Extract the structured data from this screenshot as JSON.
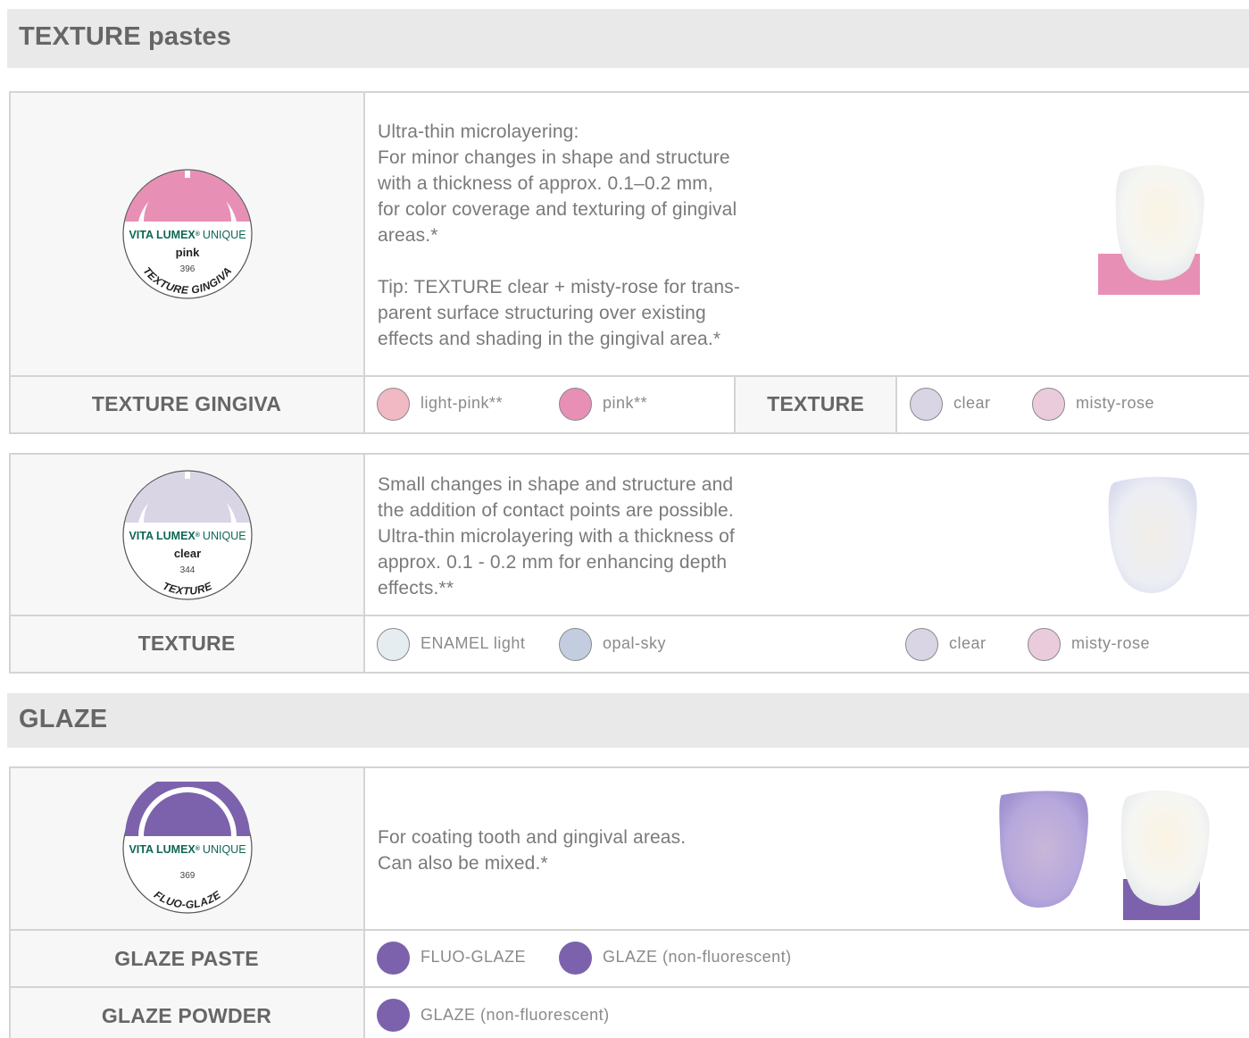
{
  "colors": {
    "pink": "#e88fb5",
    "light_pink": "#f1b9c3",
    "clear": "#d9d5e4",
    "misty_rose": "#eacbdc",
    "enamel_light": "#e6edf1",
    "opal_sky": "#c2cde0",
    "glaze_purple": "#7c62ac",
    "vita_green": "#0e6655"
  },
  "texture_section": {
    "title": "TEXTURE pastes"
  },
  "gingiva_block": {
    "jar": {
      "brand": "VITA LUMEX",
      "reg": "®",
      "product": "UNIQUE",
      "shade": "pink",
      "number": "396",
      "arc_text": "TEXTURE GINGIVA"
    },
    "description": "Ultra-thin microlayering:\nFor minor changes in shape and structure\nwith a thickness of approx. 0.1–0.2 mm,\nfor color coverage and texturing of gingival\nareas.*\n\nTip: TEXTURE clear + misty-rose for trans-\nparent surface structuring over existing\neffects and shading in the gingival area.*",
    "row_label": "TEXTURE GINGIVA",
    "swatches": [
      {
        "label": "light-pink**",
        "color": "#f1b9c3"
      },
      {
        "label": "pink**",
        "color": "#e88fb5"
      }
    ],
    "row_label_2": "TEXTURE",
    "swatches_2": [
      {
        "label": "clear",
        "color": "#d9d5e4"
      },
      {
        "label": "misty-rose",
        "color": "#eacbdc"
      }
    ]
  },
  "clear_block": {
    "jar": {
      "brand": "VITA LUMEX",
      "reg": "®",
      "product": "UNIQUE",
      "shade": "clear",
      "number": "344",
      "arc_text": "TEXTURE"
    },
    "description": "Small changes in shape and structure and\nthe addition of contact points are possible.\nUltra-thin microlayering with a thickness of\napprox. 0.1 - 0.2 mm for enhancing depth\neffects.**",
    "row_label": "TEXTURE",
    "swatches": [
      {
        "label": "ENAMEL light",
        "color": "#e6edf1"
      },
      {
        "label": "opal-sky",
        "color": "#c2cde0"
      },
      {
        "label": "clear",
        "color": "#d9d5e4"
      },
      {
        "label": "misty-rose",
        "color": "#eacbdc"
      }
    ]
  },
  "glaze_section": {
    "title": "GLAZE"
  },
  "glaze_block": {
    "jar": {
      "brand": "VITA LUMEX",
      "reg": "®",
      "product": "UNIQUE",
      "number": "369",
      "arc_text": "FLUO-GLAZE"
    },
    "description": "For coating tooth and gingival areas.\nCan also be mixed.*",
    "paste_label": "GLAZE PASTE",
    "paste_swatches": [
      {
        "label": "FLUO-GLAZE",
        "color": "#7c62ac"
      },
      {
        "label": "GLAZE (non-fluorescent)",
        "color": "#7c62ac"
      }
    ],
    "powder_label": "GLAZE POWDER",
    "powder_swatches": [
      {
        "label": "GLAZE (non-fluorescent)",
        "color": "#7c62ac"
      }
    ]
  }
}
